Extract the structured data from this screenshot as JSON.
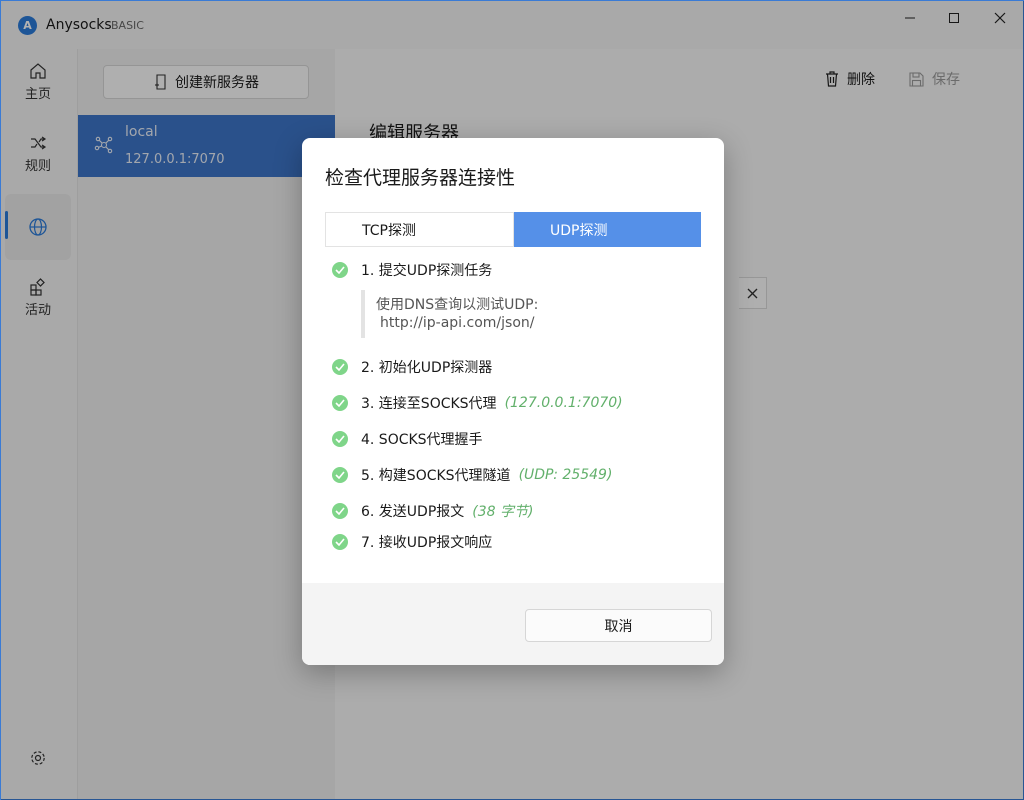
{
  "app": {
    "logo_letter": "A",
    "name": "Anysocks",
    "edition": "BASIC"
  },
  "nav": {
    "items": [
      {
        "label": "主页",
        "icon": "home-icon"
      },
      {
        "label": "规则",
        "icon": "shuffle-icon"
      },
      {
        "label": "",
        "icon": "globe-icon",
        "active": true
      },
      {
        "label": "活动",
        "icon": "apps-add-icon"
      }
    ],
    "settings_icon": "gear-icon"
  },
  "server_list": {
    "create_label": "创建新服务器",
    "servers": [
      {
        "name": "local",
        "address": "127.0.0.1:7070",
        "selected": true
      }
    ]
  },
  "main": {
    "title": "编辑服务器",
    "delete_label": "删除",
    "save_label": "保存"
  },
  "dialog": {
    "title": "检查代理服务器连接性",
    "tabs": [
      {
        "label": "TCP探测",
        "active": false
      },
      {
        "label": "UDP探测",
        "active": true
      }
    ],
    "steps": [
      {
        "text": "1. 提交UDP探测任务",
        "note": ""
      },
      {
        "text": "2. 初始化UDP探测器",
        "note": ""
      },
      {
        "text": "3. 连接至SOCKS代理",
        "note": "(127.0.0.1:7070)"
      },
      {
        "text": "4. SOCKS代理握手",
        "note": ""
      },
      {
        "text": "5. 构建SOCKS代理隧道",
        "note": "(UDP: 25549)"
      },
      {
        "text": "6. 发送UDP报文",
        "note": "(38 字节)"
      },
      {
        "text": "7. 接收UDP报文响应",
        "note": ""
      }
    ],
    "sub_info": {
      "line1": "使用DNS查询以测试UDP:",
      "line2": "http://ip-api.com/json/"
    },
    "cancel_label": "取消"
  },
  "colors": {
    "accent": "#3d74c7",
    "tab_active": "#5590e8",
    "success": "#7fd589",
    "note": "#62b06b"
  }
}
